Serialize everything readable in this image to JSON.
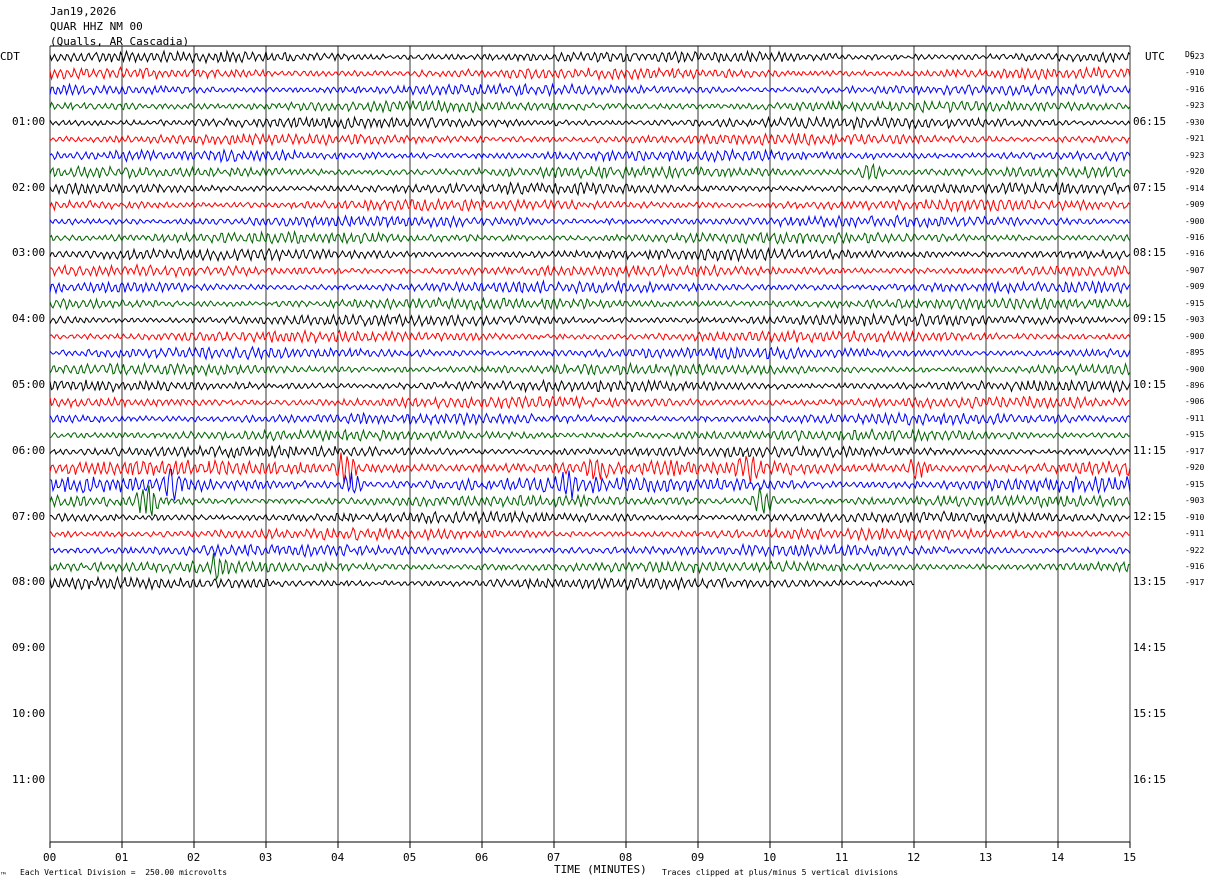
{
  "header": {
    "date": "Jan19,2026",
    "station": "QUAR HHZ NM 00",
    "location": "(Qualls, AR Cascadia)"
  },
  "left_tz": "CDT",
  "right_tz": "UTC",
  "dc_label": "DC",
  "footer": {
    "scale": "Each Vertical Division =  250.00 microvolts",
    "clip": "Traces clipped at plus/minus 5 vertical divisions",
    "marker": "™"
  },
  "colors": {
    "black": "#000000",
    "red": "#ff0000",
    "blue": "#0000ff",
    "green": "#006400",
    "grid": "#000000"
  },
  "chart_data": {
    "type": "line",
    "title": "QUAR HHZ NM 00",
    "xlabel": "TIME (MINUTES)",
    "x_ticks": [
      "00",
      "01",
      "02",
      "03",
      "04",
      "05",
      "06",
      "07",
      "08",
      "09",
      "10",
      "11",
      "12",
      "13",
      "14",
      "15"
    ],
    "xlim": [
      0,
      15
    ],
    "left_hour_labels": [
      "01:00",
      "02:00",
      "03:00",
      "04:00",
      "05:00",
      "06:00",
      "07:00",
      "08:00",
      "09:00",
      "10:00",
      "11:00"
    ],
    "right_hour_labels": [
      "06:15",
      "07:15",
      "08:15",
      "09:15",
      "10:15",
      "11:15",
      "12:15",
      "13:15",
      "14:15",
      "15:15",
      "16:15"
    ],
    "lines_per_hour": 4,
    "total_line_slots": 48,
    "trace_colors": [
      "black",
      "red",
      "blue",
      "green"
    ],
    "dc_offsets": [
      "-923",
      "-910",
      "-916",
      "-923",
      "-930",
      "-921",
      "-923",
      "-920",
      "-914",
      "-909",
      "-900",
      "-916",
      "-916",
      "-907",
      "-909",
      "-915",
      "-903",
      "-900",
      "-895",
      "-900",
      "-896",
      "-906",
      "-911",
      "-915",
      "-917",
      "-920",
      "-915",
      "-903",
      "-910",
      "-911",
      "-922",
      "-916",
      "-917"
    ],
    "last_line_end_minute": 12.0,
    "events": [
      {
        "line": 25,
        "minute": 4.1,
        "amp": 2.5
      },
      {
        "line": 25,
        "minute": 7.6,
        "amp": 1.8
      },
      {
        "line": 25,
        "minute": 9.7,
        "amp": 1.6
      },
      {
        "line": 25,
        "minute": 12.05,
        "amp": 1.6
      },
      {
        "line": 26,
        "minute": 1.7,
        "amp": 2.0
      },
      {
        "line": 26,
        "minute": 4.2,
        "amp": 1.8
      },
      {
        "line": 26,
        "minute": 7.2,
        "amp": 1.6
      },
      {
        "line": 27,
        "minute": 1.35,
        "amp": 2.8
      },
      {
        "line": 27,
        "minute": 9.9,
        "amp": 2.2
      },
      {
        "line": 7,
        "minute": 11.4,
        "amp": 1.5
      },
      {
        "line": 31,
        "minute": 2.3,
        "amp": 1.4
      }
    ]
  }
}
